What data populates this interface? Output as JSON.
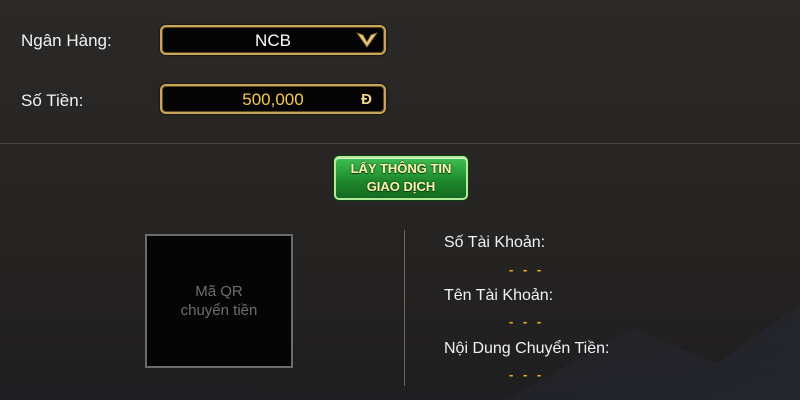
{
  "form": {
    "bank_label": "Ngân Hàng:",
    "bank_value": "NCB",
    "amount_label": "Số Tiền:",
    "amount_value": "500,000",
    "currency_symbol": "Đ"
  },
  "action": {
    "button_line1": "LẤY THÔNG TIN",
    "button_line2": "GIAO DỊCH"
  },
  "qr": {
    "line1": "Mã QR",
    "line2": "chuyển tiền"
  },
  "info": {
    "account_number_label": "Số Tài Khoản:",
    "account_number_value": "- - -",
    "account_name_label": "Tên Tài Khoản:",
    "account_name_value": "- - -",
    "transfer_content_label": "Nội Dung Chuyển Tiền:",
    "transfer_content_value": "- - -"
  },
  "colors": {
    "field_border": "#c9a55a",
    "amount_text": "#f4c94a",
    "button_green": "#1f8b2e",
    "dash_color": "#f2b31f"
  }
}
